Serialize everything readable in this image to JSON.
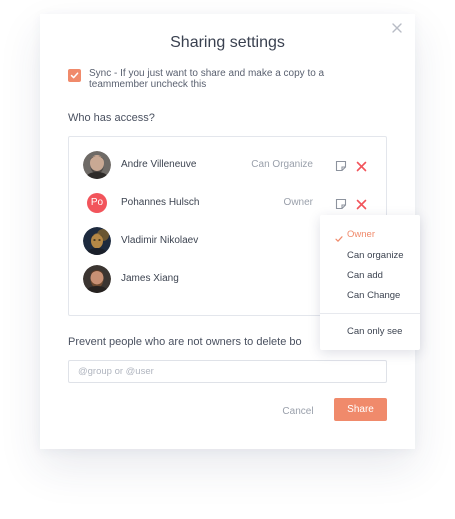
{
  "dialog": {
    "title": "Sharing settings",
    "sync": {
      "checked": true,
      "text": "Sync - If you just want to share and make a copy to a teammember uncheck this"
    },
    "who_label": "Who has access?",
    "users": [
      {
        "name": "Andre Villeneuve",
        "role": "Can Organize",
        "avatar": "photo"
      },
      {
        "name": "Pohannes Hulsch",
        "role": "Owner",
        "avatar": "initials",
        "initials": "Po"
      },
      {
        "name": "Vladimir Nikolaev",
        "role": "",
        "avatar": "photo"
      },
      {
        "name": "James Xiang",
        "role": "",
        "avatar": "photo"
      }
    ],
    "role_menu": {
      "items": [
        "Owner",
        "Can organize",
        "Can add",
        "Can Change",
        "Can only see"
      ],
      "selected": "Owner"
    },
    "prevent_label": "Prevent people who are not owners to delete bo",
    "group_input": {
      "placeholder": "@group or @user",
      "value": ""
    },
    "cancel_label": "Cancel",
    "share_label": "Share"
  },
  "colors": {
    "accent": "#f08a6b",
    "danger": "#f2545b",
    "text": "#3d4451",
    "muted": "#9aa0ab",
    "border": "#e3e6ec"
  },
  "icons": {
    "close": "close-icon",
    "check": "check-icon",
    "edit": "edit-icon",
    "remove": "remove-icon"
  }
}
